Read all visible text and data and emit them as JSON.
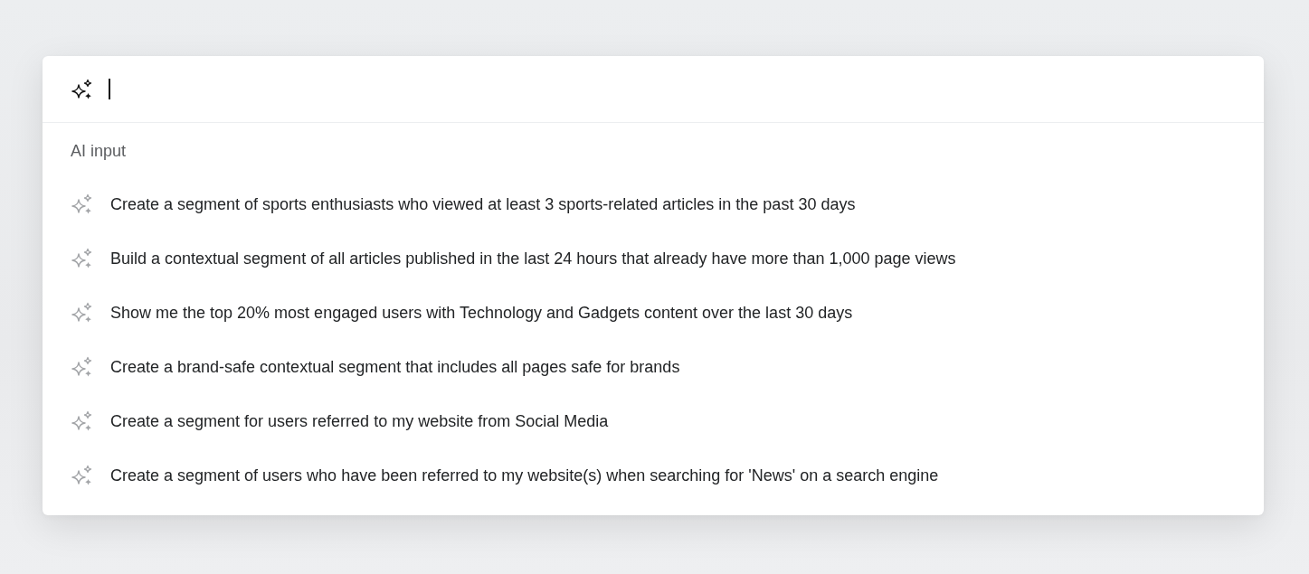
{
  "input": {
    "focused": true
  },
  "section_label": "AI input",
  "suggestions": [
    {
      "text": "Create a segment of sports enthusiasts who viewed at least 3 sports-related articles in the past 30 days"
    },
    {
      "text": "Build a contextual segment of all articles published in the last 24 hours that already have more than 1,000 page views"
    },
    {
      "text": "Show me the top 20% most engaged users with Technology and Gadgets content over the last 30 days"
    },
    {
      "text": "Create a brand-safe contextual segment that includes all pages safe for brands"
    },
    {
      "text": "Create a segment for users referred to my website from Social Media"
    },
    {
      "text": "Create a segment of users who have been referred to my website(s) when searching for 'News' on a search engine"
    }
  ]
}
